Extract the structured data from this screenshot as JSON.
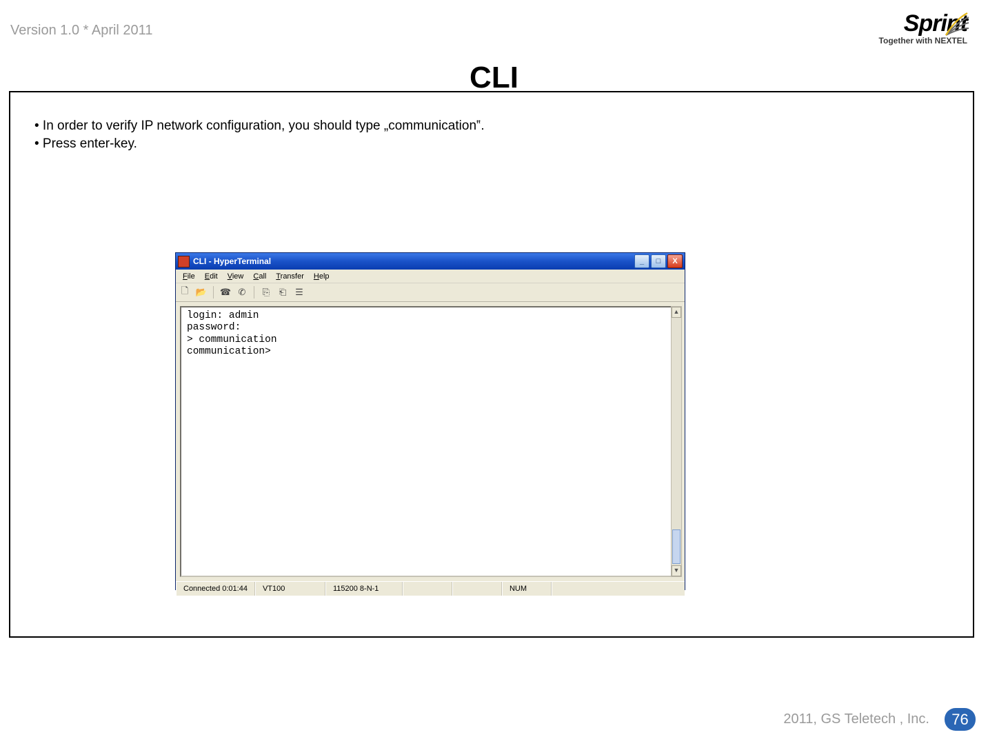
{
  "header": {
    "version": "Version 1.0 * April 2011",
    "brand": "Sprint",
    "tagline": "Together with NEXTEL",
    "title": "CLI"
  },
  "bullets": {
    "b1": "• In order to verify IP network configuration, you should type „communication‟.",
    "b2": "• Press enter-key."
  },
  "hyperterminal": {
    "titlebar": "CLI - HyperTerminal",
    "window_buttons": {
      "min": "_",
      "max": "□",
      "close": "X"
    },
    "menu": {
      "file": "File",
      "edit": "Edit",
      "view": "View",
      "call": "Call",
      "transfer": "Transfer",
      "help": "Help"
    },
    "terminal": {
      "line1": "login: admin",
      "line2": "password:",
      "line3": "> communication",
      "line4": "communication>"
    },
    "status": {
      "connected": "Connected 0:01:44",
      "emulation": "VT100",
      "settings": "115200 8-N-1",
      "num": "NUM"
    }
  },
  "footer": {
    "copyright": "2011, GS Teletech , Inc.",
    "page": "76"
  }
}
